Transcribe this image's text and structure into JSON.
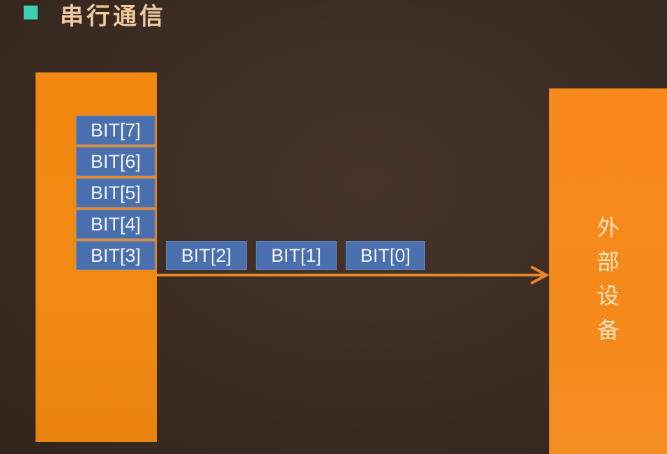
{
  "title": "串行通信",
  "colors": {
    "background": "#3a2a20",
    "block_orange": "#f2880f",
    "bit_cell": "#4a6fae",
    "arrow": "#e8842a",
    "bullet": "#3ecfb4"
  },
  "bits_stack": [
    "BIT[7]",
    "BIT[6]",
    "BIT[5]",
    "BIT[4]",
    "BIT[3]"
  ],
  "bits_row": [
    "BIT[2]",
    "BIT[1]",
    "BIT[0]"
  ],
  "device": {
    "chars": [
      "外",
      "部",
      "设",
      "备"
    ]
  }
}
